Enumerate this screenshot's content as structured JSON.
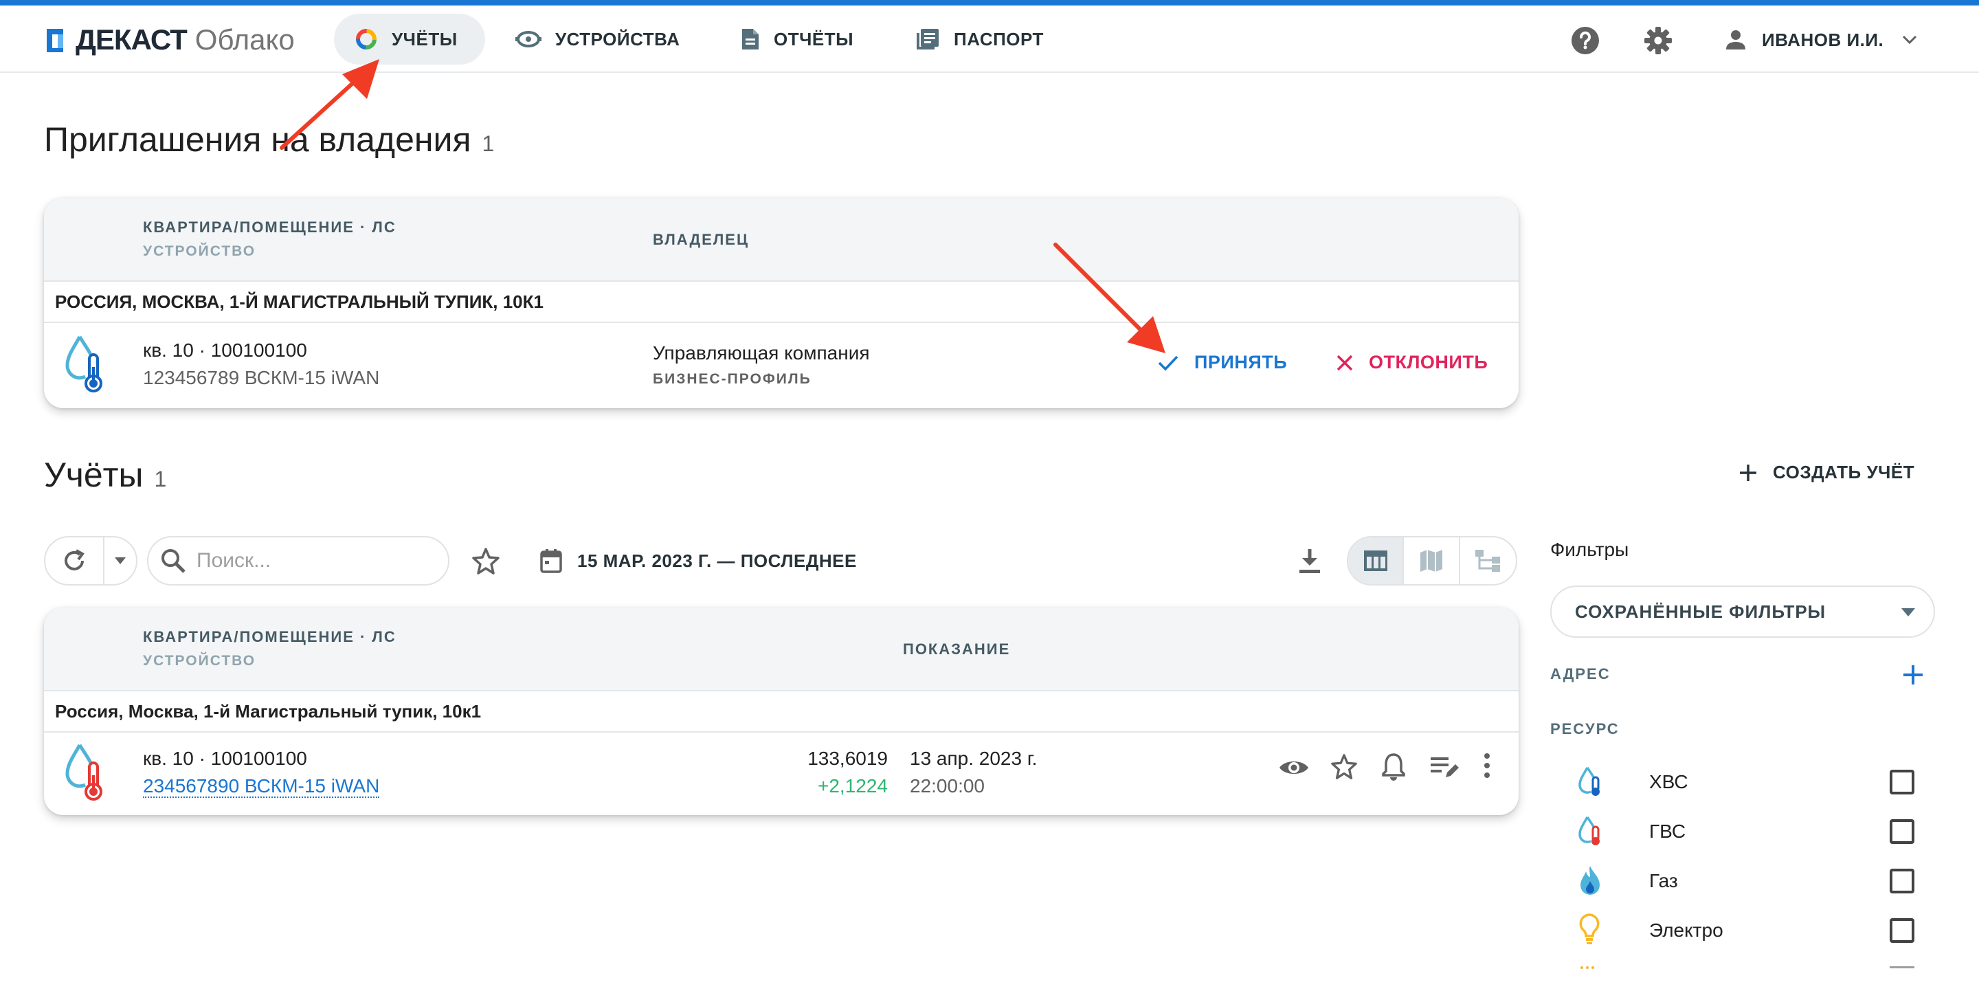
{
  "header": {
    "brand": "ДЕКАСТ",
    "brand_sub": "Облако",
    "nav": [
      {
        "label": "УЧЁТЫ",
        "icon": "ring-chart-icon",
        "active": true
      },
      {
        "label": "УСТРОЙСТВА",
        "icon": "meter-icon",
        "active": false
      },
      {
        "label": "ОТЧЁТЫ",
        "icon": "document-icon",
        "active": false
      },
      {
        "label": "ПАСПОРТ",
        "icon": "library-icon",
        "active": false
      }
    ],
    "user": "ИВАНОВ И.И."
  },
  "invitations": {
    "title": "Приглашения на владения",
    "count": "1",
    "col_apartment": "КВАРТИРА/ПОМЕЩЕНИЕ · ЛС",
    "col_device": "УСТРОЙСТВО",
    "col_owner": "ВЛАДЕЛЕЦ",
    "group": "РОССИЯ, МОСКВА, 1-Й МАГИСТРАЛЬНЫЙ ТУПИК, 10К1",
    "row": {
      "apartment": "кв. 10 · 100100100",
      "device": "123456789 ВСКМ-15 iWAN",
      "owner": "Управляющая компания",
      "owner_type": "БИЗНЕС-ПРОФИЛЬ",
      "accept": "ПРИНЯТЬ",
      "decline": "ОТКЛОНИТЬ"
    }
  },
  "accounts": {
    "title": "Учёты",
    "count": "1",
    "create": "СОЗДАТЬ УЧЁТ",
    "search_placeholder": "Поиск...",
    "date_range": "15 МАР. 2023 Г. — ПОСЛЕДНЕЕ",
    "col_apartment": "КВАРТИРА/ПОМЕЩЕНИЕ · ЛС",
    "col_device": "УСТРОЙСТВО",
    "col_reading": "ПОКАЗАНИЕ",
    "group": "Россия, Москва, 1-й Магистральный тупик, 10к1",
    "row": {
      "apartment": "кв. 10 · 100100100",
      "device": "234567890 ВСКМ-15 iWAN",
      "reading": "133,6019",
      "delta": "+2,1224",
      "date": "13 апр. 2023 г.",
      "time": "22:00:00"
    }
  },
  "filters": {
    "title": "Фильтры",
    "saved": "СОХРАНЁННЫЕ ФИЛЬТРЫ",
    "address": "АДРЕС",
    "resource": "РЕСУРС",
    "resources": [
      {
        "name": "ХВС",
        "icon": "cold-water-icon"
      },
      {
        "name": "ГВС",
        "icon": "hot-water-icon"
      },
      {
        "name": "Газ",
        "icon": "gas-flame-icon"
      },
      {
        "name": "Электро",
        "icon": "lightbulb-icon"
      }
    ]
  },
  "colors": {
    "accent": "#1976d2",
    "decline": "#e0245e",
    "positive": "#2bb673",
    "annotation": "#f03c24"
  }
}
